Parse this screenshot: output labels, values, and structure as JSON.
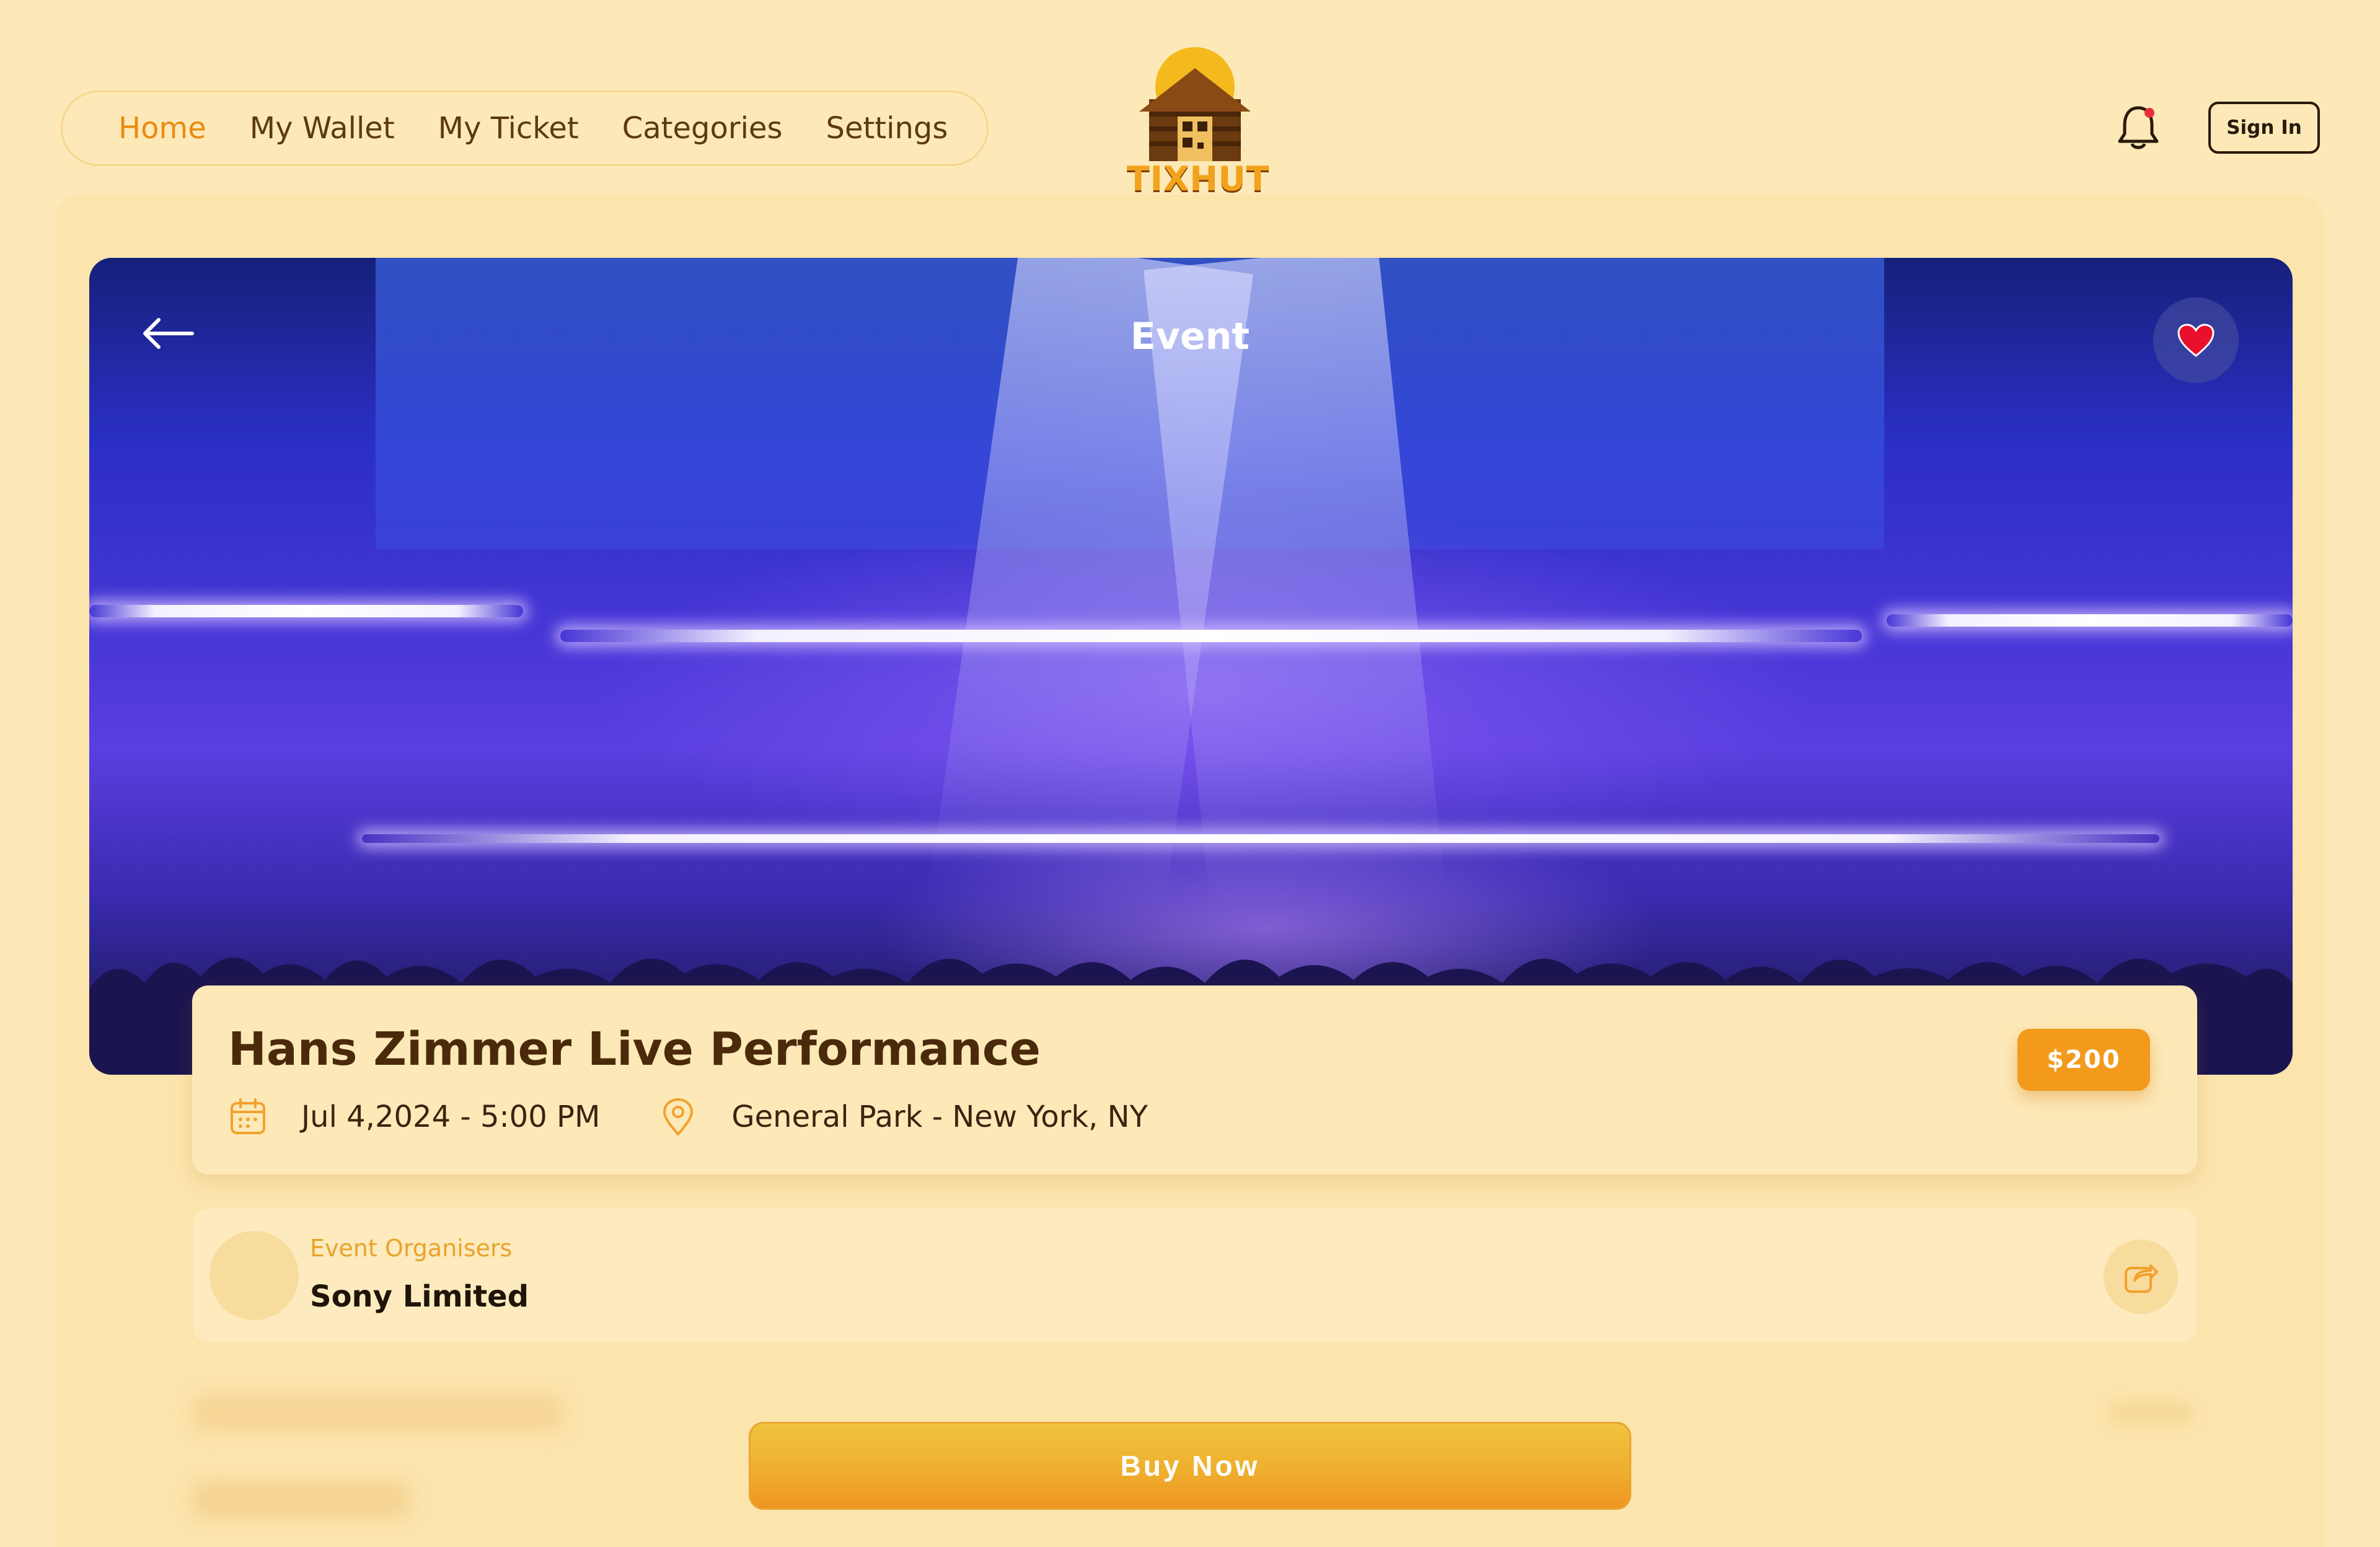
{
  "nav": {
    "items": [
      {
        "label": "Home",
        "active": true
      },
      {
        "label": "My Wallet",
        "active": false
      },
      {
        "label": "My Ticket",
        "active": false
      },
      {
        "label": "Categories",
        "active": false
      },
      {
        "label": "Settings",
        "active": false
      }
    ]
  },
  "logo": {
    "text": "TIXHUT"
  },
  "header": {
    "signin_label": "Sign In",
    "notification_icon": "bell-icon"
  },
  "hero": {
    "title": "Event",
    "back_icon": "arrow-left-icon",
    "favorite_icon": "heart-icon"
  },
  "event": {
    "title": "Hans Zimmer Live Performance",
    "date": "Jul 4,2024 - 5:00 PM",
    "location": "General Park - New York, NY",
    "price": "$200"
  },
  "organizer": {
    "label": "Event Organisers",
    "name": "Sony Limited"
  },
  "actions": {
    "buy_label": "Buy Now"
  },
  "colors": {
    "background": "#fde9b8",
    "accent": "#f39a1c",
    "active_nav": "#e98b12",
    "heart": "#e8102a"
  }
}
